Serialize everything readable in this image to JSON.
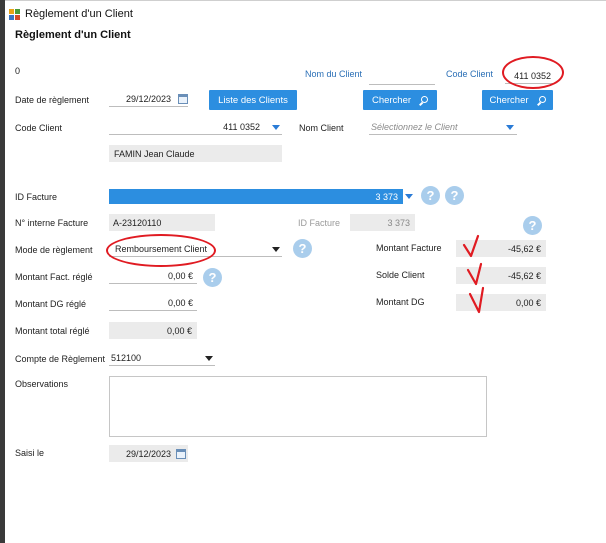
{
  "window": {
    "title": "Règlement d'un Client",
    "icon": "ledger-app-icon"
  },
  "page": {
    "title": "Règlement d'un Client",
    "top_left_value": "0"
  },
  "search": {
    "nom_label": "Nom du Client",
    "nom_value": "",
    "code_label": "Code Client",
    "code_value": "411 0352",
    "search_button_left": "Chercher",
    "search_button_right": "Chercher",
    "list_button": "Liste des Clients"
  },
  "form": {
    "date_reglement_label": "Date de règlement",
    "date_reglement_value": "29/12/2023",
    "code_client_label": "Code Client",
    "code_client_value": "411 0352",
    "nom_client_label": "Nom Client",
    "nom_client_placeholder": "Sélectionnez le Client",
    "client_name": "FAMIN Jean Claude",
    "id_facture_label": "ID Facture",
    "id_facture_value": "3 373",
    "n_interne_label": "N° interne Facture",
    "n_interne_value": "A-23120110",
    "id_facture2_label": "ID Facture",
    "id_facture2_value": "3 373",
    "mode_label": "Mode de règlement",
    "mode_value": "Remboursement Client",
    "montant_fact_regle_label": "Montant Fact. réglé",
    "montant_fact_regle_value": "0,00 €",
    "montant_dg_regle_label": "Montant DG réglé",
    "montant_dg_regle_value": "0,00 €",
    "montant_total_label": "Montant total réglé",
    "montant_total_value": "0,00 €",
    "compte_label": "Compte de Règlement",
    "compte_value": "512100",
    "observations_label": "Observations",
    "observations_value": "",
    "saisi_label": "Saisi le",
    "saisi_value": "29/12/2023",
    "montant_facture_label": "Montant Facture",
    "montant_facture_value": "-45,62 €",
    "solde_client_label": "Solde Client",
    "solde_client_value": "-45,62 €",
    "montant_dg_label": "Montant DG",
    "montant_dg_value": "0,00 €"
  },
  "help_glyph": "?",
  "colors": {
    "accent": "#2c8ee0",
    "link": "#2a6fb6",
    "annotation": "#e01b22",
    "help": "#a9cdec"
  }
}
